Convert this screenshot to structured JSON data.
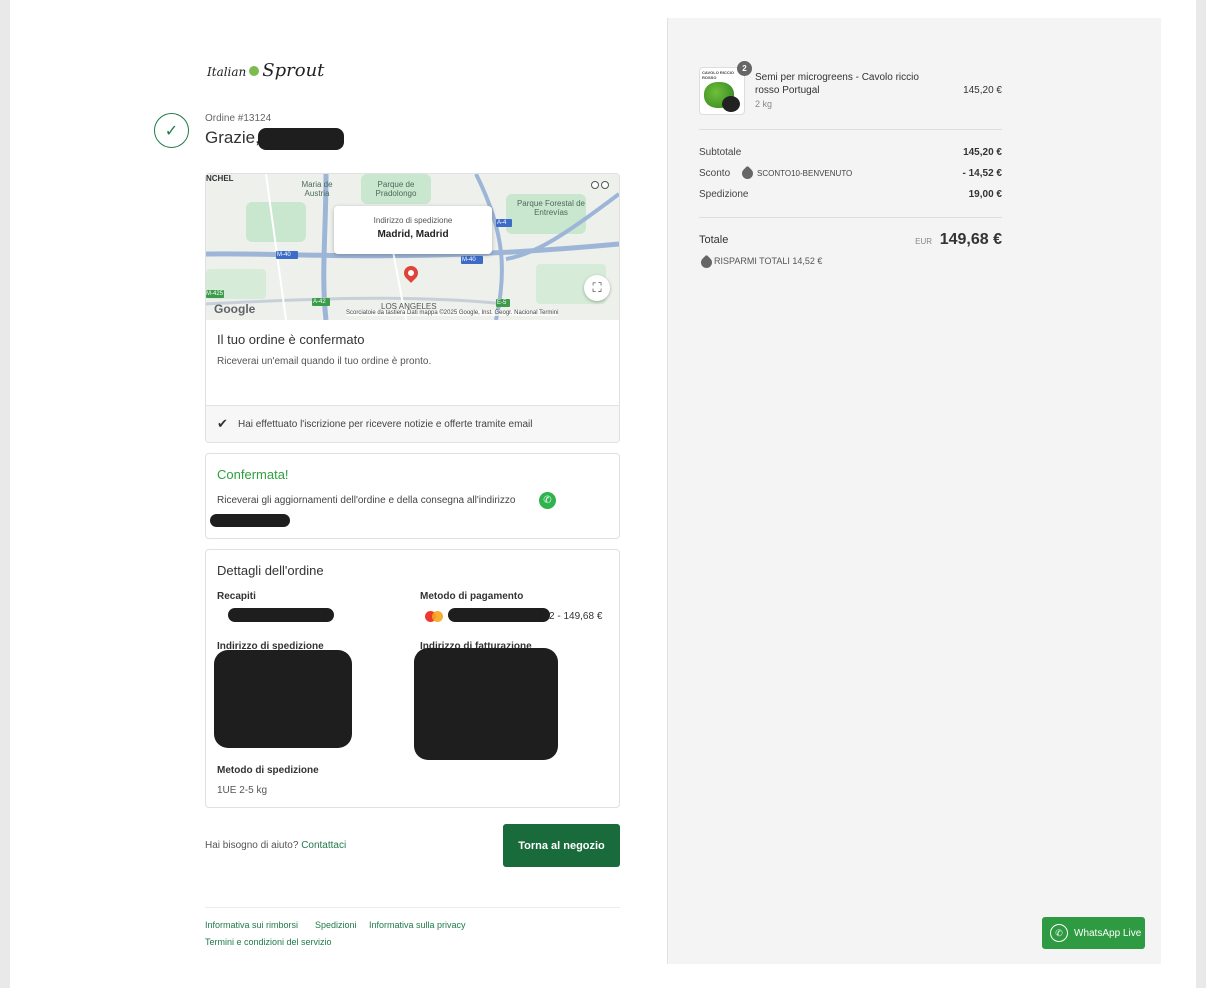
{
  "logo": {
    "part1": "Italian",
    "part2": "Sprout"
  },
  "order": {
    "number": "Ordine #13124",
    "thanks": "Grazie,"
  },
  "map": {
    "popup_label": "Indirizzo di spedizione",
    "popup_city": "Madrid, Madrid",
    "labels": [
      "NCHEL",
      "Maria de Austria",
      "Parque de Pradolongo",
      "Parque Forestal de Entrevías",
      "LOS ANGELES"
    ],
    "roads": [
      "M-40",
      "M-40",
      "M-40",
      "A-4",
      "A-42",
      "M-425",
      "E-5"
    ],
    "google": "Google",
    "attribution": "Scorciatoie da tastiera   Dati mappa ©2025 Google, Inst. Geogr. Nacional   Termini"
  },
  "confirmation": {
    "title": "Il tuo ordine è confermato",
    "subtitle": "Riceverai un'email quando il tuo ordine è pronto.",
    "newsletter": "Hai effettuato l'iscrizione per ricevere notizie e offerte tramite email"
  },
  "whatsapp_update": {
    "title": "Confermata!",
    "subtitle": "Riceverai gli aggiornamenti dell'ordine e della consegna all'indirizzo"
  },
  "details": {
    "title": "Dettagli dell'ordine",
    "contacts_label": "Recapiti",
    "payment_label": "Metodo di pagamento",
    "payment_value": "2 - 149,68 €",
    "shipping_address_label": "Indirizzo di spedizione",
    "billing_address_label": "Indirizzo di fatturazione",
    "shipping_method_label": "Metodo di spedizione",
    "shipping_method_value": "1UE 2-5 kg"
  },
  "help": {
    "text": "Hai bisogno di aiuto?",
    "link": "Contattaci"
  },
  "back_button": "Torna al negozio",
  "footer_links": [
    "Informativa sui rimborsi",
    "Spedizioni",
    "Informativa sulla privacy",
    "Termini e condizioni del servizio"
  ],
  "cart": {
    "item": {
      "quantity": "2",
      "name": "Semi per microgreens - Cavolo riccio rosso Portugal",
      "weight": "2 kg",
      "price": "145,20 €"
    },
    "subtotal_label": "Subtotale",
    "subtotal_value": "145,20 €",
    "discount_label": "Sconto",
    "discount_code": "SCONTO10-BENVENUTO",
    "discount_value": "- 14,52 €",
    "shipping_label": "Spedizione",
    "shipping_value": "19,00 €",
    "total_label": "Totale",
    "currency": "EUR",
    "total_value": "149,68 €",
    "savings": "RISPARMI TOTALI 14,52 €"
  },
  "whatsapp_live": "WhatsApp Live",
  "colors": {
    "brand_green": "#1a6b3c",
    "success_green": "#2fa13b",
    "whatsapp_green": "#2e9a41"
  }
}
